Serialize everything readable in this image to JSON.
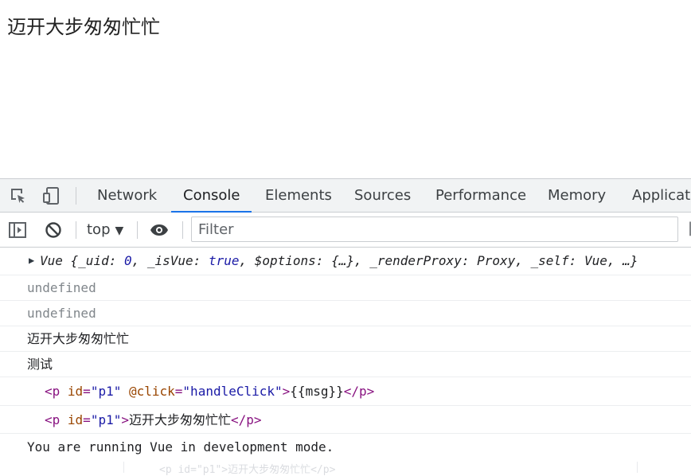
{
  "page": {
    "heading": "迈开大步匆匆忙忙"
  },
  "devtools": {
    "tabs": [
      {
        "label": "Network"
      },
      {
        "label": "Console",
        "active": true
      },
      {
        "label": "Elements"
      },
      {
        "label": "Sources"
      },
      {
        "label": "Performance"
      },
      {
        "label": "Memory"
      },
      {
        "label": "Applicatio"
      }
    ],
    "toolbar": {
      "context": "top",
      "context_caret": "▼",
      "filter_placeholder": "Filter"
    },
    "console": {
      "vue_object": {
        "prefix": "Vue {",
        "uid_key": "_uid: ",
        "uid_val": "0",
        "sep1": ", ",
        "isvue_key": "_isVue: ",
        "isvue_val": "true",
        "rest": ", $options: {…}, _renderProxy: Proxy, _self: Vue, …}"
      },
      "undefined_1": "undefined",
      "undefined_2": "undefined",
      "log_msg": "迈开大步匆匆忙忙",
      "log_test": "测试",
      "template_line": {
        "open": "<p",
        "attr1_name": " id",
        "eq1": "=",
        "attr1_val": "\"p1\"",
        "attr2_name": " @click",
        "eq2": "=",
        "attr2_val": "\"handleClick\"",
        "close_open": ">",
        "text": "{{msg}}",
        "end_tag": "</p>"
      },
      "rendered_line": {
        "open": "<p",
        "attr1_name": " id",
        "eq1": "=",
        "attr1_val": "\"p1\"",
        "close_open": ">",
        "text": "迈开大步匆匆忙忙",
        "end_tag": "</p>"
      },
      "dev_mode_msg": "You are running Vue in development mode.",
      "ghost_text": "<p id=\"p1\">迈开大步匆匆忙忙</p>"
    }
  },
  "colors": {
    "accent": "#1a73e8",
    "tag": "#881280",
    "attr_name": "#994500",
    "attr_value": "#1a1aa6"
  }
}
